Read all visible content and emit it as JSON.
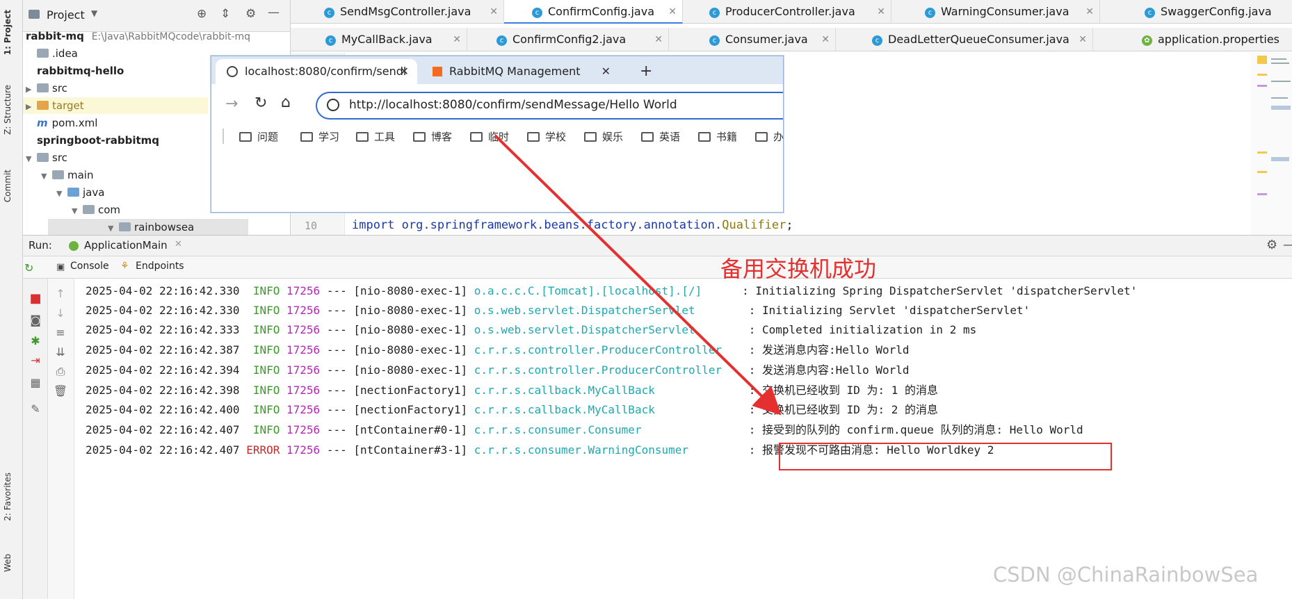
{
  "left_strip": {
    "project_tab": "1: Project",
    "structure_tab": "Z: Structure",
    "commit_tab": "Commit",
    "favorites_tab": "2: Favorites",
    "web_tab": "Web"
  },
  "project_panel": {
    "title": "Project",
    "tree": [
      {
        "label": "rabbit-mq",
        "path": "E:\\Java\\RabbitMQcode\\rabbit-mq",
        "bold": true
      },
      {
        "label": ".idea"
      },
      {
        "label": "rabbitmq-hello",
        "bold": true
      },
      {
        "label": "src"
      },
      {
        "label": "target"
      },
      {
        "label": "pom.xml"
      },
      {
        "label": "springboot-rabbitmq",
        "bold": true
      },
      {
        "label": "src"
      },
      {
        "label": "main"
      },
      {
        "label": "java"
      },
      {
        "label": "com"
      },
      {
        "label": "rainbowsea"
      }
    ]
  },
  "editor": {
    "tabs_row1": [
      "SendMsgController.java",
      "ConfirmConfig.java",
      "ProducerController.java",
      "WarningConsumer.java",
      "SwaggerConfig.java"
    ],
    "tabs_row2": [
      "MyCallBack.java",
      "ConfirmConfig2.java",
      "Consumer.java",
      "DeadLetterQueueConsumer.java",
      "application.properties"
    ],
    "line_number": "10",
    "code_line": "import org.springframework.beans.factory.annotation.",
    "code_annotation": "Qualifier",
    "code_end": ";"
  },
  "browser": {
    "tab1": "localhost:8080/confirm/sendl",
    "tab2": "RabbitMQ Management",
    "new_tab": "+",
    "url": "http://localhost:8080/confirm/sendMessage/Hello World",
    "bookmarks": [
      "问题",
      "学习",
      "工具",
      "博客",
      "临时",
      "学校",
      "娱乐",
      "英语",
      "书籍",
      "办"
    ]
  },
  "run_panel": {
    "run_label": "Run:",
    "app_tab": "ApplicationMain",
    "console_tab": "Console",
    "endpoints_tab": "Endpoints",
    "logs": [
      {
        "ts": "2025-04-02 22:16:42.330",
        "level": "INFO",
        "pid": "17256",
        "thread": "--- [nio-8080-exec-1]",
        "logger": "o.a.c.c.C.[Tomcat].[localhost].[/]     ",
        "msg": ": Initializing Spring DispatcherServlet 'dispatcherServlet'"
      },
      {
        "ts": "2025-04-02 22:16:42.330",
        "level": "INFO",
        "pid": "17256",
        "thread": "--- [nio-8080-exec-1]",
        "logger": "o.s.web.servlet.DispatcherServlet       ",
        "msg": ": Initializing Servlet 'dispatcherServlet'"
      },
      {
        "ts": "2025-04-02 22:16:42.333",
        "level": "INFO",
        "pid": "17256",
        "thread": "--- [nio-8080-exec-1]",
        "logger": "o.s.web.servlet.DispatcherServlet       ",
        "msg": ": Completed initialization in 2 ms"
      },
      {
        "ts": "2025-04-02 22:16:42.387",
        "level": "INFO",
        "pid": "17256",
        "thread": "--- [nio-8080-exec-1]",
        "logger": "c.r.r.s.controller.ProducerController   ",
        "msg": ": 发送消息内容:Hello World"
      },
      {
        "ts": "2025-04-02 22:16:42.394",
        "level": "INFO",
        "pid": "17256",
        "thread": "--- [nio-8080-exec-1]",
        "logger": "c.r.r.s.controller.ProducerController   ",
        "msg": ": 发送消息内容:Hello World"
      },
      {
        "ts": "2025-04-02 22:16:42.398",
        "level": "INFO",
        "pid": "17256",
        "thread": "--- [nectionFactory1]",
        "logger": "c.r.r.s.callback.MyCallBack             ",
        "msg": ": 交换机已经收到 ID 为: 1 的消息"
      },
      {
        "ts": "2025-04-02 22:16:42.400",
        "level": "INFO",
        "pid": "17256",
        "thread": "--- [nectionFactory1]",
        "logger": "c.r.r.s.callback.MyCallBack             ",
        "msg": ": 交换机已经收到 ID 为: 2 的消息"
      },
      {
        "ts": "2025-04-02 22:16:42.407",
        "level": "INFO",
        "pid": "17256",
        "thread": "--- [ntContainer#0-1]",
        "logger": "c.r.r.s.consumer.Consumer               ",
        "msg": ": 接受到的队列的 confirm.queue 队列的消息: Hello World"
      },
      {
        "ts": "2025-04-02 22:16:42.407",
        "level": "ERROR",
        "pid": "17256",
        "thread": "--- [ntContainer#3-1]",
        "logger": "c.r.r.s.consumer.WarningConsumer        ",
        "msg": ": 报警发现不可路由消息: Hello Worldkey 2"
      }
    ]
  },
  "annotation": {
    "text": "备用交换机成功",
    "color": "#e53030"
  },
  "watermark": "CSDN @ChinaRainbowSea"
}
